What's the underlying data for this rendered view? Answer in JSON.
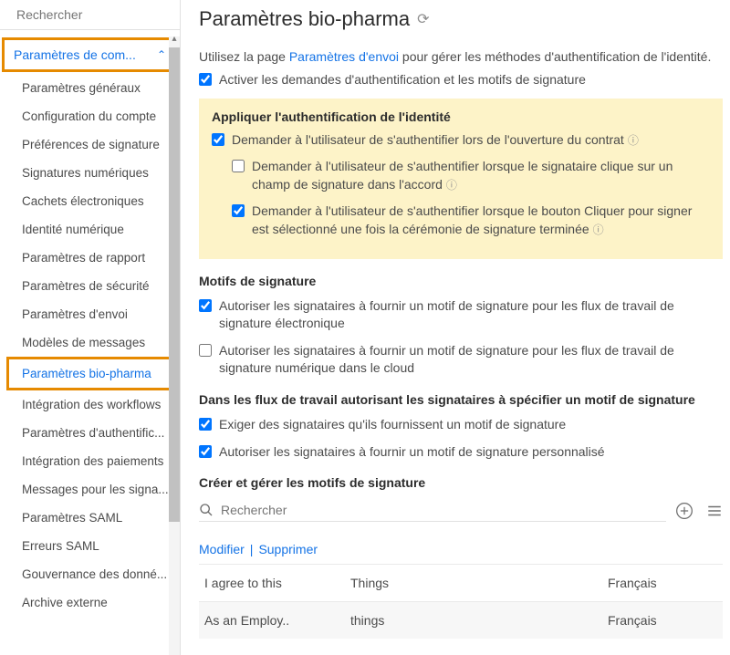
{
  "sidebar": {
    "search_placeholder": "Rechercher",
    "header": "Paramètres de com...",
    "items": [
      "Paramètres généraux",
      "Configuration du compte",
      "Préférences de signature",
      "Signatures numériques",
      "Cachets électroniques",
      "Identité numérique",
      "Paramètres de rapport",
      "Paramètres de sécurité",
      "Paramètres d'envoi",
      "Modèles de messages",
      "Paramètres bio-pharma",
      "Intégration des workflows",
      "Paramètres d'authentific...",
      "Intégration des paiements",
      "Messages pour les signa...",
      "Paramètres SAML",
      "Erreurs SAML",
      "Gouvernance des donné...",
      "Archive externe"
    ],
    "active_index": 10
  },
  "page": {
    "title": "Paramètres bio-pharma",
    "intro_prefix": "Utilisez la page ",
    "intro_link": "Paramètres d'envoi",
    "intro_suffix": " pour gérer les méthodes d'authentification de l'identité.",
    "activate_label": "Activer les demandes d'authentification et les motifs de signature"
  },
  "auth_panel": {
    "title": "Appliquer l'authentification de l'identité",
    "item1": "Demander à l'utilisateur de s'authentifier lors de l'ouverture du contrat",
    "item2": "Demander à l'utilisateur de s'authentifier lorsque le signataire clique sur un champ de signature dans l'accord",
    "item3": "Demander à l'utilisateur de s'authentifier lorsque le bouton Cliquer pour signer est sélectionné une fois la cérémonie de signature terminée"
  },
  "motifs": {
    "title": "Motifs de signature",
    "item1": "Autoriser les signataires à fournir un motif de signature pour les flux de travail de signature électronique",
    "item2": "Autoriser les signataires à fournir un motif de signature pour les flux de travail de signature numérique dans le cloud"
  },
  "workflow": {
    "title": "Dans les flux de travail autorisant les signataires à spécifier un motif de signature",
    "item1": "Exiger des signataires qu'ils fournissent un motif de signature",
    "item2": "Autoriser les signataires à fournir un motif de signature personnalisé"
  },
  "table": {
    "title": "Créer et gérer les motifs de signature",
    "search_placeholder": "Rechercher",
    "action_modify": "Modifier",
    "action_delete": "Supprimer",
    "rows": [
      {
        "c1": "I agree to this",
        "c2": "Things",
        "c3": "Français"
      },
      {
        "c1": "As an Employ..",
        "c2": "things",
        "c3": "Français"
      }
    ]
  }
}
